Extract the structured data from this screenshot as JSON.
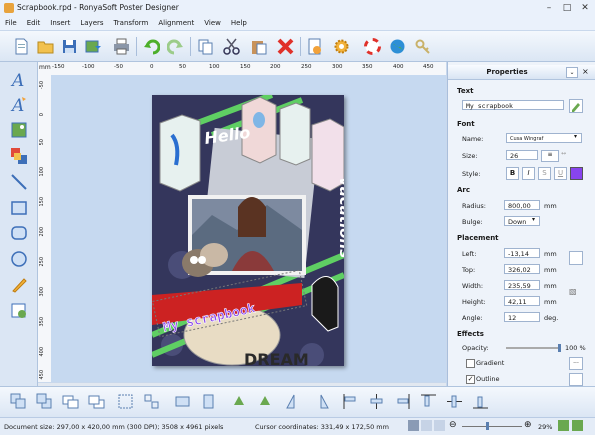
{
  "window": {
    "title": "Scrapbook.rpd - RonyaSoft Poster Designer"
  },
  "menu": [
    "File",
    "Edit",
    "Insert",
    "Layers",
    "Transform",
    "Alignment",
    "View",
    "Help"
  ],
  "ruler": {
    "unit": "mm",
    "top_ticks": [
      "-150",
      "-100",
      "-50",
      "0",
      "50",
      "100",
      "150",
      "200",
      "250",
      "300",
      "350",
      "400",
      "450"
    ],
    "left_ticks": [
      "-50",
      "0",
      "50",
      "100",
      "150",
      "200",
      "250",
      "300",
      "350",
      "400",
      "450"
    ]
  },
  "poster": {
    "hello_text": "Hello",
    "vacations_text": "vacations",
    "scrapbook_text": "My scrapbook",
    "dream_text": "DREAM"
  },
  "properties": {
    "title": "Properties",
    "text_section": "Text",
    "text_value": "My scrapbook",
    "font_section": "Font",
    "name_label": "Name:",
    "name_value": "Cusa Wingraf",
    "size_label": "Size:",
    "size_value": "26",
    "style_label": "Style:",
    "style_bold": "B",
    "style_italic": "I",
    "style_s": "S",
    "style_u": "U",
    "arc_section": "Arc",
    "radius_label": "Radius:",
    "radius_value": "800,00",
    "radius_unit": "mm",
    "bulge_label": "Bulge:",
    "bulge_value": "Down",
    "placement_section": "Placement",
    "left_label": "Left:",
    "left_value": "-13,14",
    "left_unit": "mm",
    "top_label": "Top:",
    "top_value": "326,02",
    "top_unit": "mm",
    "width_label": "Width:",
    "width_value": "235,59",
    "width_unit": "mm",
    "height_label": "Height:",
    "height_value": "42,11",
    "height_unit": "mm",
    "angle_label": "Angle:",
    "angle_value": "12",
    "angle_unit": "deg.",
    "effects_section": "Effects",
    "opacity_label": "Opacity:",
    "opacity_value": "100 %",
    "gradient_label": "Gradient",
    "outline_label": "Outline",
    "text_color": "#8844ee"
  },
  "status": {
    "document_size": "Document size: 297,00 x 420,00 mm (300 DPI); 3508 x 4961 pixels",
    "cursor": "Cursor coordinates: 331,49 x 172,50 mm",
    "zoom": "29%"
  }
}
